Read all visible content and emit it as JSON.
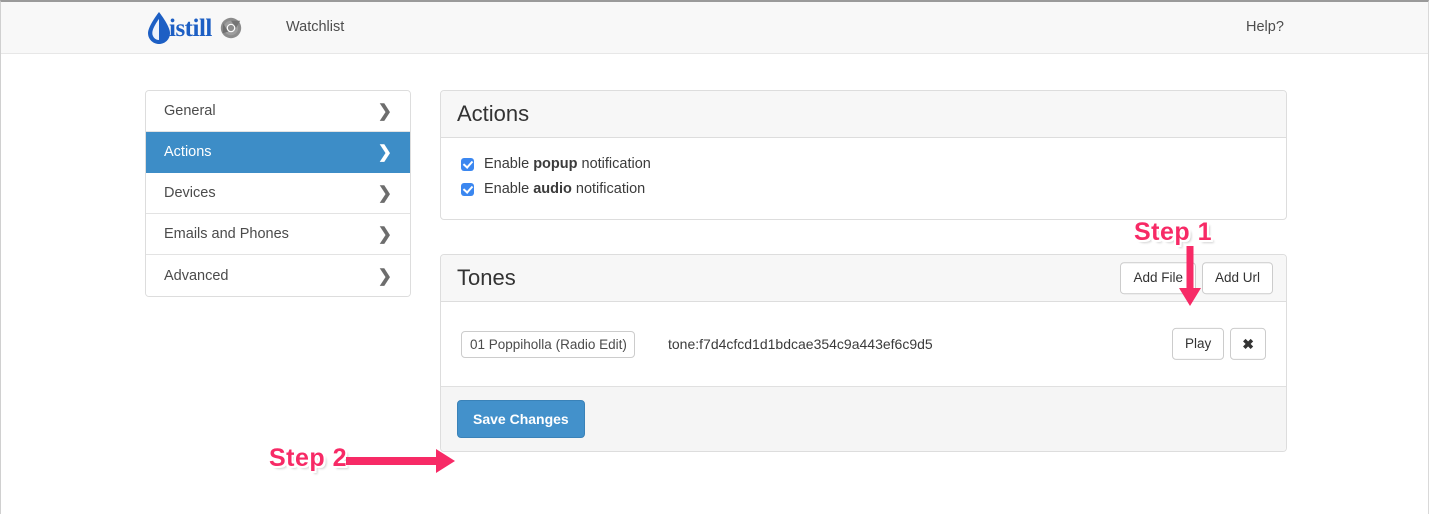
{
  "colors": {
    "brand_blue": "#1d5fc4",
    "accent_blue": "#3d8dc7",
    "primary_button": "#4391cb",
    "checkbox_blue": "#3b87f0",
    "annotation_pink": "#f72a66",
    "panel_header_bg": "#f7f7f7",
    "navbar_bg": "#f8f8f8"
  },
  "header": {
    "brand_text": "istill",
    "brand_icons": {
      "droplet": "droplet-icon",
      "chrome": "chrome-icon"
    },
    "watchlist_label": "Watchlist",
    "help_label": "Help?"
  },
  "sidebar": {
    "items": [
      {
        "label": "General",
        "active": false
      },
      {
        "label": "Actions",
        "active": true
      },
      {
        "label": "Devices",
        "active": false
      },
      {
        "label": "Emails and Phones",
        "active": false
      },
      {
        "label": "Advanced",
        "active": false
      }
    ],
    "chevron": "❯"
  },
  "actions_panel": {
    "title": "Actions",
    "checkboxes": [
      {
        "prefix": "Enable ",
        "bold": "popup",
        "suffix": " notification",
        "checked": true
      },
      {
        "prefix": "Enable ",
        "bold": "audio",
        "suffix": " notification",
        "checked": true
      }
    ]
  },
  "tones_panel": {
    "title": "Tones",
    "add_file_label": "Add File",
    "add_url_label": "Add Url",
    "tone_row": {
      "name_value": "01 Poppiholla (Radio Edit)",
      "name_placeholder": "Tone name",
      "hash_text": "tone:f7d4cfcd1d1bdcae354c9a443ef6c9d5",
      "play_label": "Play",
      "remove_label": "✖"
    },
    "save_label": "Save Changes"
  },
  "annotations": [
    {
      "label": "Step 1",
      "arrow": "arrow-down"
    },
    {
      "label": "Step 2",
      "arrow": "arrow-right"
    }
  ]
}
